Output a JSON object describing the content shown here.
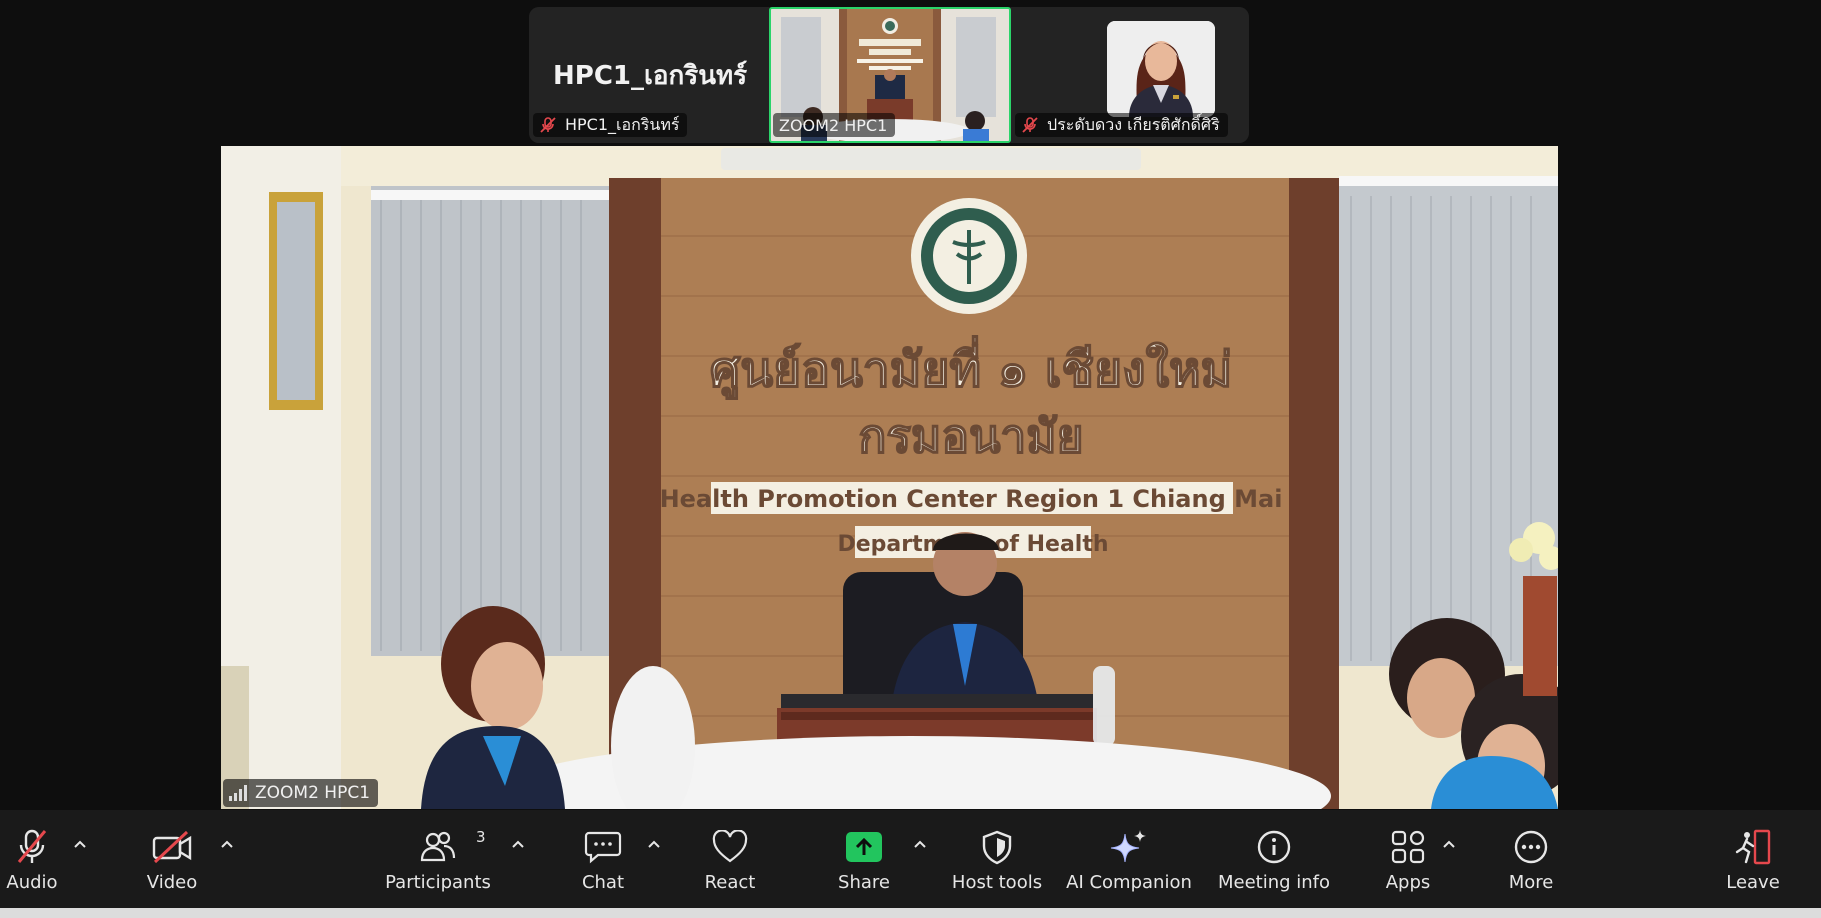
{
  "strip": {
    "tile1": {
      "name_big": "HPC1_เอกรินทร์",
      "label": "HPC1_เอกรินทร์",
      "muted": true
    },
    "tile2": {
      "label": "ZOOM2 HPC1",
      "muted": false,
      "active_speaker": true
    },
    "tile3": {
      "label": "ประดับดวง เกียรติศักดิ์ศิริ",
      "muted": true
    }
  },
  "main_video": {
    "label": "ZOOM2 HPC1",
    "sign": {
      "line1": "ศูนย์อนามัยที่ ๑ เชียงใหม่",
      "line2": "กรมอนามัย",
      "line3": "Health Promotion Center Region 1 Chiang Mai",
      "line4": "Department of Health"
    }
  },
  "toolbar": {
    "audio": {
      "label": "Audio",
      "icon": "mic-off-icon"
    },
    "video": {
      "label": "Video",
      "icon": "video-off-icon"
    },
    "participants": {
      "label": "Participants",
      "count": "3",
      "icon": "participants-icon"
    },
    "chat": {
      "label": "Chat",
      "icon": "chat-icon"
    },
    "react": {
      "label": "React",
      "icon": "heart-icon"
    },
    "share": {
      "label": "Share",
      "icon": "share-screen-icon"
    },
    "host_tools": {
      "label": "Host tools",
      "icon": "shield-icon"
    },
    "ai_companion": {
      "label": "AI Companion",
      "icon": "sparkle-icon"
    },
    "meeting_info": {
      "label": "Meeting info",
      "icon": "info-icon"
    },
    "apps": {
      "label": "Apps",
      "icon": "apps-icon"
    },
    "more": {
      "label": "More",
      "icon": "more-icon"
    },
    "leave": {
      "label": "Leave",
      "icon": "leave-icon"
    }
  },
  "colors": {
    "active_border": "#2bd46a",
    "share_green": "#22c55e",
    "muted_red": "#e5484d",
    "leave_red": "#e5484d"
  }
}
